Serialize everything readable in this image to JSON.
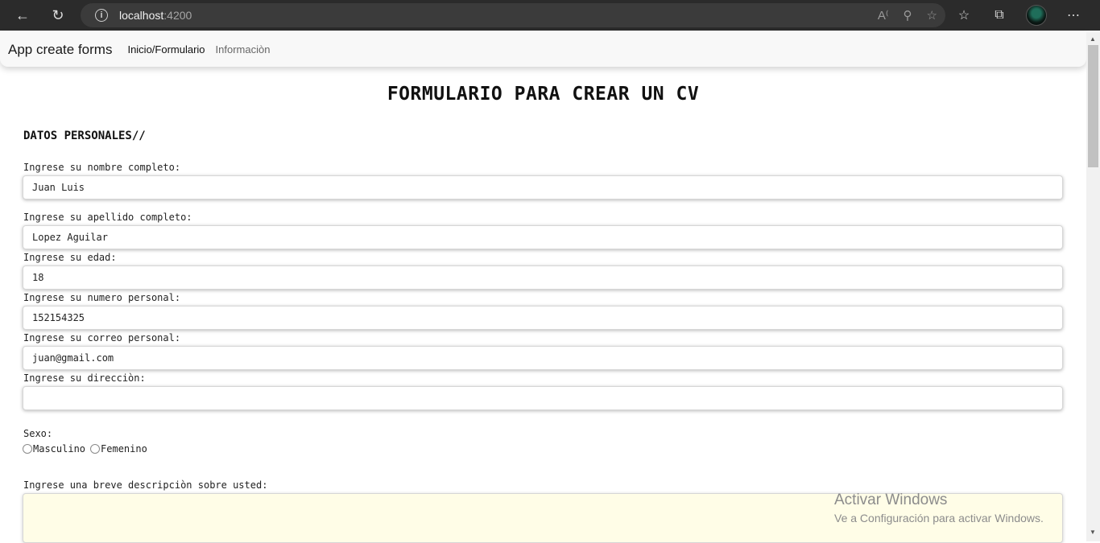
{
  "browser": {
    "url_host": "localhost",
    "url_port": ":4200"
  },
  "navbar": {
    "brand": "App create forms",
    "links": [
      "Inicio/Formulario",
      "Informaciòn"
    ]
  },
  "form": {
    "title": "FORMULARIO PARA CREAR UN CV",
    "section": "DATOS PERSONALES//",
    "fields": [
      {
        "label": "Ingrese su nombre completo:",
        "value": "Juan Luis"
      },
      {
        "label": "Ingrese su apellido completo:",
        "value": "Lopez Aguilar"
      },
      {
        "label": "Ingrese su edad:",
        "value": "18"
      },
      {
        "label": "Ingrese su numero personal:",
        "value": "152154325"
      },
      {
        "label": "Ingrese su correo personal:",
        "value": "juan@gmail.com"
      },
      {
        "label": "Ingrese su direcciòn:",
        "value": ""
      }
    ],
    "sex_label": "Sexo:",
    "sex_options": [
      "Masculino",
      "Femenino"
    ],
    "description_label": "Ingrese una breve descripciòn sobre usted:"
  },
  "watermark": {
    "line1": "Activar Windows",
    "line2": "Ve a Configuración para activar Windows."
  }
}
